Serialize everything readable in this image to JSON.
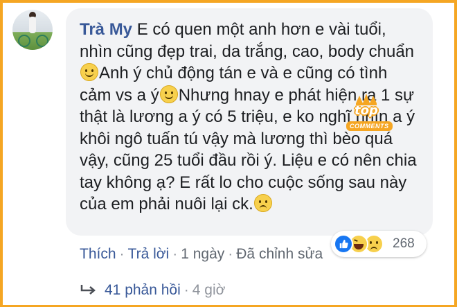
{
  "comment": {
    "author": "Trà My",
    "segments": [
      " E có quen một anh hơn e vài tuổi, nhìn cũng đẹp trai, da trắng, cao, body chuẩn",
      "Anh ý chủ động tán e và e cũng có tình cảm vs a ý",
      "Nhưng hnay e phát hiện ra 1 sự thật là lương a ý có 5 triệu, e ko nghĩ nhìn a ý khôi ngô tuấn tú vậy mà lương thì bèo quá vậy, cũng 25 tuổi đầu rồi ý. Liệu e có nên chia tay không ạ? E rất lo cho cuộc sống sau này của em phải nuôi lại ck."
    ]
  },
  "badge": {
    "top": "top",
    "comments": "COMMENTS"
  },
  "reactions": {
    "count": "268",
    "types": [
      "like-icon",
      "haha-icon",
      "sad-icon"
    ]
  },
  "actions": {
    "like": "Thích",
    "reply": "Trả lời",
    "time": "1 ngày",
    "edited": "Đã chỉnh sửa"
  },
  "replies": {
    "label": "41 phản hồi",
    "time": "4 giờ"
  },
  "colors": {
    "frame": "#f5a623",
    "author": "#385898",
    "bubble": "#f2f3f5",
    "like_blue": "#1877f2"
  }
}
